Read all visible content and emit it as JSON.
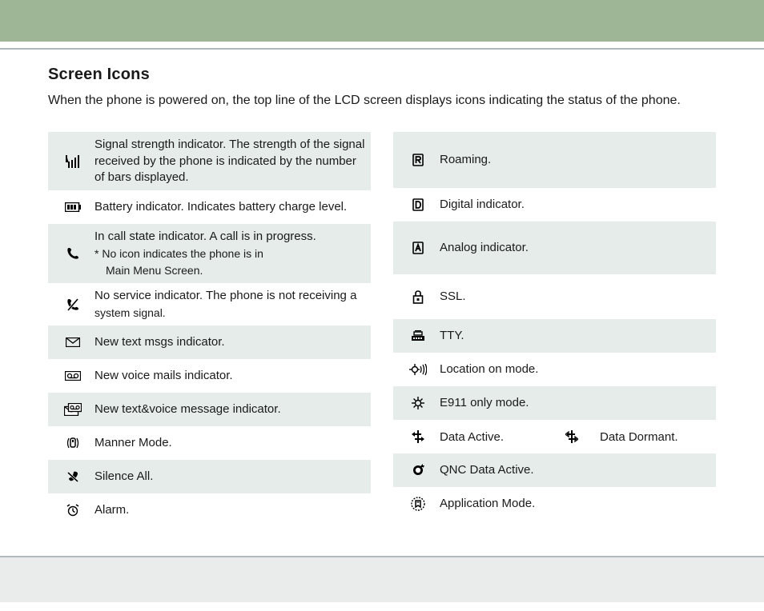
{
  "title": "Screen Icons",
  "intro": "When the phone is powered on, the top line of the LCD screen displays icons indicating the status of the phone.",
  "left": {
    "r0": "Signal strength indicator. The strength of the signal received by the phone is indicated by the number of bars displayed.",
    "r1": "Battery indicator. Indicates battery charge level.",
    "r2a": "In call state indicator. A call is in progress.",
    "r2b": "* No icon indicates the phone is in",
    "r2c": "Main Menu Screen.",
    "r3a": "No service indicator. The phone is not receiving a",
    "r3b": "system signal.",
    "r4": "New text msgs indicator.",
    "r5": "New voice mails indicator.",
    "r6": "New text&voice message indicator.",
    "r7": "Manner Mode.",
    "r8": "Silence All.",
    "r9": "Alarm."
  },
  "right": {
    "r0": "Roaming.",
    "r1": "Digital indicator.",
    "r2": "Analog indicator.",
    "r3": "SSL.",
    "r4": "TTY.",
    "r5": "Location on mode.",
    "r6": "E911 only mode.",
    "r7a": "Data Active.",
    "r7b": "Data Dormant.",
    "r8": "QNC Data Active.",
    "r9": "Application Mode."
  }
}
